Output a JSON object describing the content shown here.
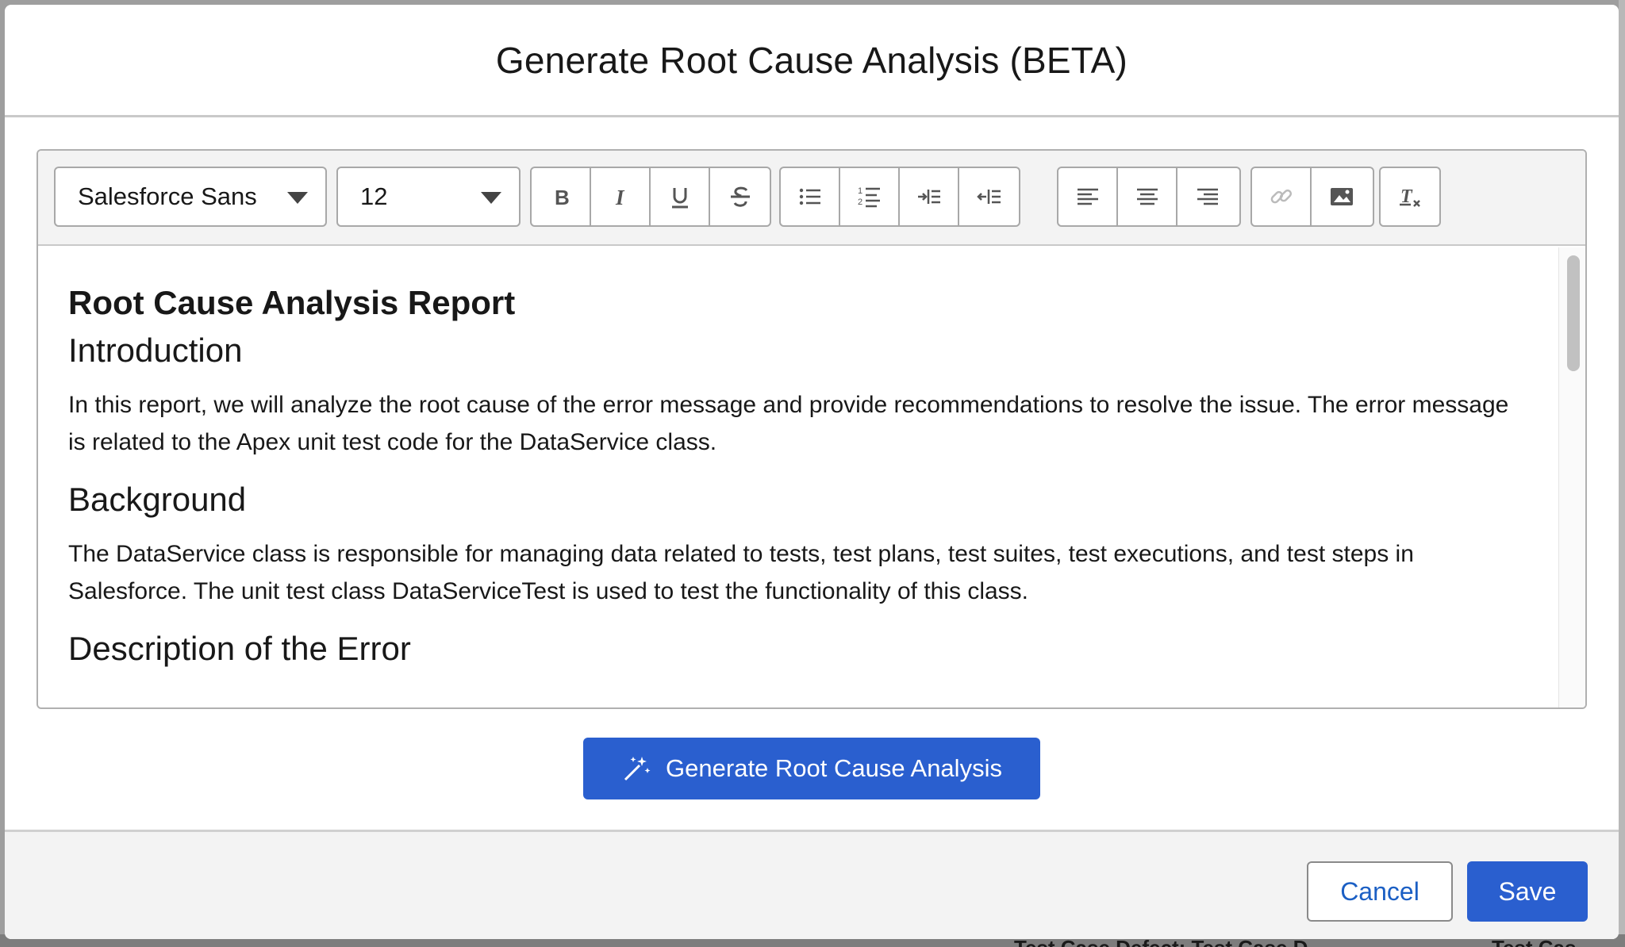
{
  "modal": {
    "title": "Generate Root Cause Analysis (BETA)"
  },
  "toolbar": {
    "font_family": "Salesforce Sans",
    "font_size": "12",
    "buttons": {
      "bold": "bold-icon",
      "italic": "italic-icon",
      "underline": "underline-icon",
      "strikethrough": "strikethrough-icon",
      "bullet_list": "bullet-list-icon",
      "numbered_list": "numbered-list-icon",
      "indent": "indent-icon",
      "outdent": "outdent-icon",
      "align_left": "align-left-icon",
      "align_center": "align-center-icon",
      "align_right": "align-right-icon",
      "link": "link-icon",
      "image": "image-icon",
      "clear_format": "clear-formatting-icon"
    }
  },
  "content": {
    "report_title": "Root Cause Analysis Report",
    "sections": [
      {
        "heading": "Introduction",
        "text": "In this report, we will analyze the root cause of the error message and provide recommendations to resolve the issue. The error message is related to the Apex unit test code for the DataService class."
      },
      {
        "heading": "Background",
        "text": "The DataService class is responsible for managing data related to tests, test plans, test suites, test executions, and test steps in Salesforce. The unit test class DataServiceTest is used to test the functionality of this class."
      },
      {
        "heading": "Description of the Error",
        "text": ""
      }
    ]
  },
  "actions": {
    "generate_label": "Generate Root Cause Analysis",
    "cancel_label": "Cancel",
    "save_label": "Save"
  },
  "background": {
    "row_text_1": "Test Case Defect: Test Case D",
    "row_text_2": "Test Cas"
  },
  "colors": {
    "brand": "#2a5fcf",
    "link": "#1b5fc4"
  }
}
